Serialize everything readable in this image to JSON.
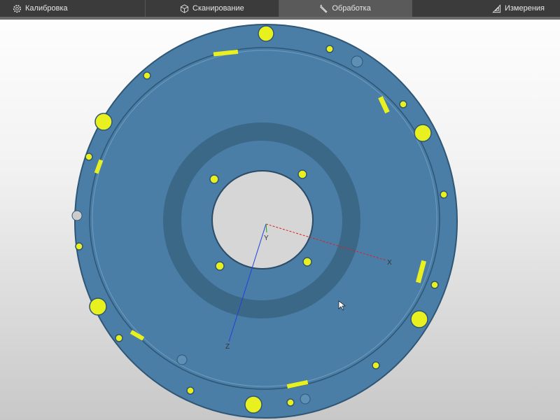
{
  "tabs": [
    {
      "label": "Калибровка",
      "icon": "gear-icon"
    },
    {
      "label": "Сканирование",
      "icon": "cube-icon"
    },
    {
      "label": "Обработка",
      "icon": "pencil-icon",
      "active": true
    },
    {
      "label": "Измерения",
      "icon": "triangle-ruler-icon"
    }
  ],
  "viewport": {
    "axes": {
      "x": "X",
      "y": "Y",
      "z": "Z"
    },
    "colors": {
      "part": "#4a7ea6",
      "highlight": "#e8f020",
      "axis_x": "#e02020",
      "axis_z": "#2040e0"
    }
  }
}
